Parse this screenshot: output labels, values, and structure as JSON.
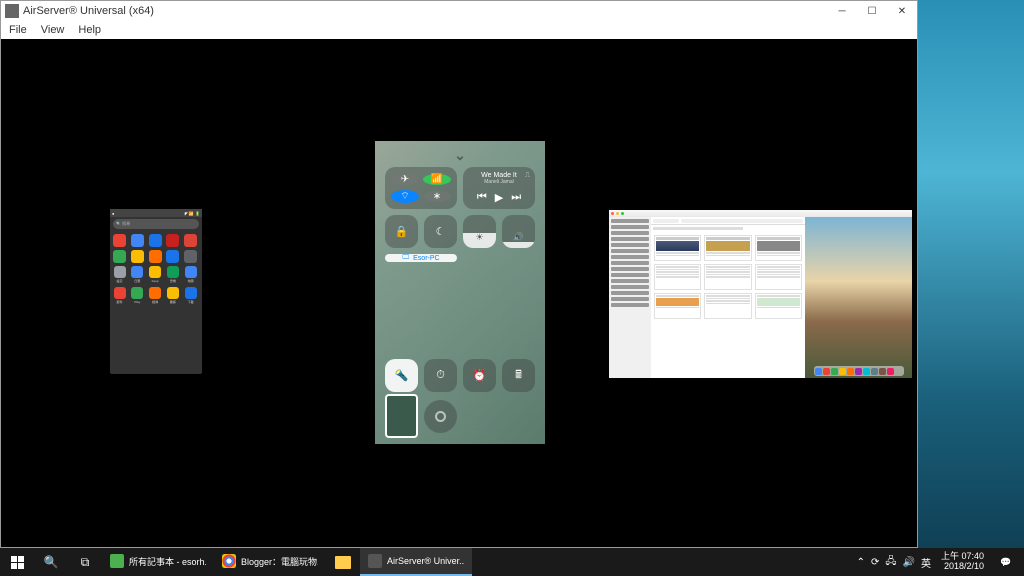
{
  "window": {
    "title": "AirServer® Universal (x64)",
    "menus": [
      "File",
      "View",
      "Help"
    ]
  },
  "ios": {
    "music_title": "We Made It",
    "music_artist": "Maneli Jamal",
    "mirror_target": "Esor-PC"
  },
  "taskbar": {
    "items": [
      {
        "label": "所有記事本 - esorh...",
        "color": "#4caf50"
      },
      {
        "label": "Blogger：電腦玩物...",
        "color": "#4285f4",
        "chrome": true
      },
      {
        "label": "",
        "color": "#ffcc4d",
        "folder": true
      },
      {
        "label": "AirServer® Univer...",
        "color": "#444",
        "active": true
      }
    ],
    "ime": "英",
    "time": "上午 07:40",
    "date": "2018/2/10"
  },
  "colors": {
    "airplane": "#f0f0f0",
    "airplane_bg": "rgba(120,120,120,0.5)",
    "cellular_bg": "#34c759",
    "wifi_bg": "#0a84ff",
    "bt_bg": "rgba(120,120,120,0.5)"
  }
}
